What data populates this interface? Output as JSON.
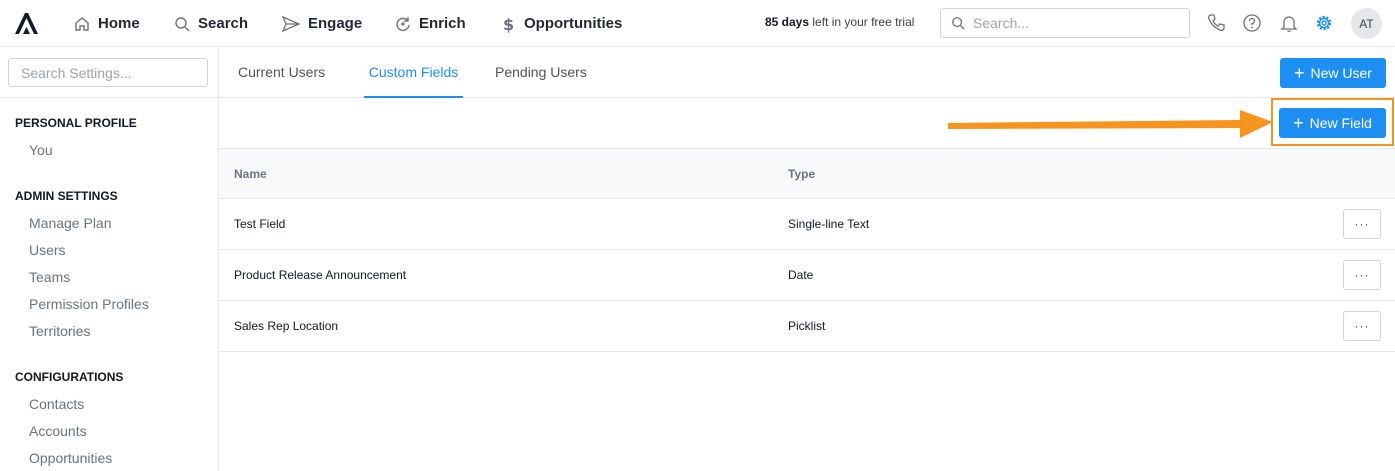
{
  "nav": {
    "items": [
      {
        "label": "Home",
        "icon": "home-icon"
      },
      {
        "label": "Search",
        "icon": "search-icon"
      },
      {
        "label": "Engage",
        "icon": "send-icon"
      },
      {
        "label": "Enrich",
        "icon": "refresh-icon"
      },
      {
        "label": "Opportunities",
        "icon": "dollar-icon"
      }
    ],
    "trial_days": "85 days",
    "trial_rest": " left in your free trial",
    "search_placeholder": "Search...",
    "avatar_initials": "AT",
    "accent": "#1d8ff2"
  },
  "sidebar": {
    "search_placeholder": "Search Settings...",
    "sections": [
      {
        "heading": "PERSONAL PROFILE",
        "items": [
          "You"
        ]
      },
      {
        "heading": "ADMIN SETTINGS",
        "items": [
          "Manage Plan",
          "Users",
          "Teams",
          "Permission Profiles",
          "Territories"
        ]
      },
      {
        "heading": "CONFIGURATIONS",
        "items": [
          "Contacts",
          "Accounts",
          "Opportunities"
        ]
      }
    ]
  },
  "tabs": [
    "Current Users",
    "Custom Fields",
    "Pending Users"
  ],
  "active_tab": "Custom Fields",
  "buttons": {
    "new_user": "New User",
    "new_field": "New Field"
  },
  "table": {
    "headers": [
      "Name",
      "Type"
    ],
    "rows": [
      {
        "name": "Test Field",
        "type": "Single-line Text"
      },
      {
        "name": "Product Release Announcement",
        "type": "Date"
      },
      {
        "name": "Sales Rep Location",
        "type": "Picklist"
      }
    ],
    "more_label": "···"
  },
  "annotation": {
    "color": "#f7941d"
  }
}
